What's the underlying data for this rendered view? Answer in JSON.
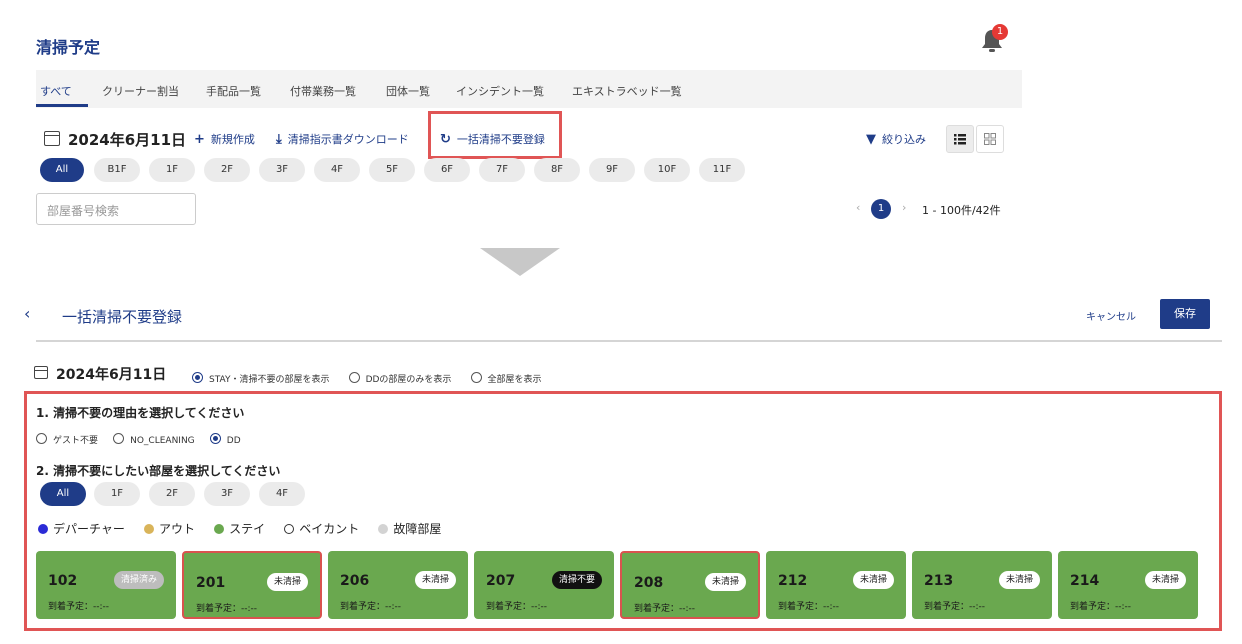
{
  "header": {
    "title": "清掃予定",
    "notification_count": "1"
  },
  "tabs": [
    "すべて",
    "クリーナー割当",
    "手配品一覧",
    "付帯業務一覧",
    "団体一覧",
    "インシデント一覧",
    "エキストラベッド一覧"
  ],
  "toolbar": {
    "date": "2024年6月11日",
    "new_label": "新規作成",
    "download_label": "清掃指示書ダウンロード",
    "bulk_label": "一括清掃不要登録",
    "filter_label": "絞り込み"
  },
  "floors": [
    "All",
    "B1F",
    "1F",
    "2F",
    "3F",
    "4F",
    "5F",
    "6F",
    "7F",
    "8F",
    "9F",
    "10F",
    "11F"
  ],
  "search": {
    "placeholder": "部屋番号検索"
  },
  "pagination": {
    "current_page": "1",
    "range_text": "1 - 100件/42件"
  },
  "bulk": {
    "title": "一括清掃不要登録",
    "cancel_label": "キャンセル",
    "save_label": "保存",
    "date": "2024年6月11日",
    "display_options": [
      "STAY・清掃不要の部屋を表示",
      "DDの部屋のみを表示",
      "全部屋を表示"
    ],
    "display_selected": 0,
    "step1_title": "1. 清掃不要の理由を選択してください",
    "reasons": [
      "ゲスト不要",
      "NO_CLEANING",
      "DD"
    ],
    "reason_selected": 2,
    "step2_title": "2. 清掃不要にしたい部屋を選択してください",
    "floors": [
      "All",
      "1F",
      "2F",
      "3F",
      "4F"
    ],
    "legend": [
      {
        "label": "デパーチャー",
        "color": "#2b2bd6"
      },
      {
        "label": "アウト",
        "color": "#d9b45a"
      },
      {
        "label": "ステイ",
        "color": "#6aa84f"
      },
      {
        "label": "ベイカント",
        "color": "#ffffff"
      },
      {
        "label": "故障部屋",
        "color": "#d3d3d3"
      }
    ],
    "rooms": [
      {
        "number": "102",
        "status": "清掃済み",
        "eta": "到着予定：--:--",
        "selected": false
      },
      {
        "number": "201",
        "status": "未清掃",
        "eta": "到着予定：--:--",
        "selected": true
      },
      {
        "number": "206",
        "status": "未清掃",
        "eta": "到着予定：--:--",
        "selected": false
      },
      {
        "number": "207",
        "status": "清掃不要",
        "eta": "到着予定：--:--",
        "selected": false
      },
      {
        "number": "208",
        "status": "未清掃",
        "eta": "到着予定：--:--",
        "selected": true
      },
      {
        "number": "212",
        "status": "未清掃",
        "eta": "到着予定：--:--",
        "selected": false
      },
      {
        "number": "213",
        "status": "未清掃",
        "eta": "到着予定：--:--",
        "selected": false
      },
      {
        "number": "214",
        "status": "未清掃",
        "eta": "到着予定：--:--",
        "selected": false
      }
    ]
  },
  "colors": {
    "primary": "#1f3c88",
    "highlight": "#e05555",
    "room_green": "#6aa84f"
  },
  "icons": [
    "bell-icon",
    "calendar-icon",
    "plus-icon",
    "download-icon",
    "refresh-icon",
    "filter-icon",
    "list-view-icon",
    "grid-view-icon",
    "chevron-left-icon",
    "chevron-right-icon",
    "back-arrow-icon"
  ]
}
